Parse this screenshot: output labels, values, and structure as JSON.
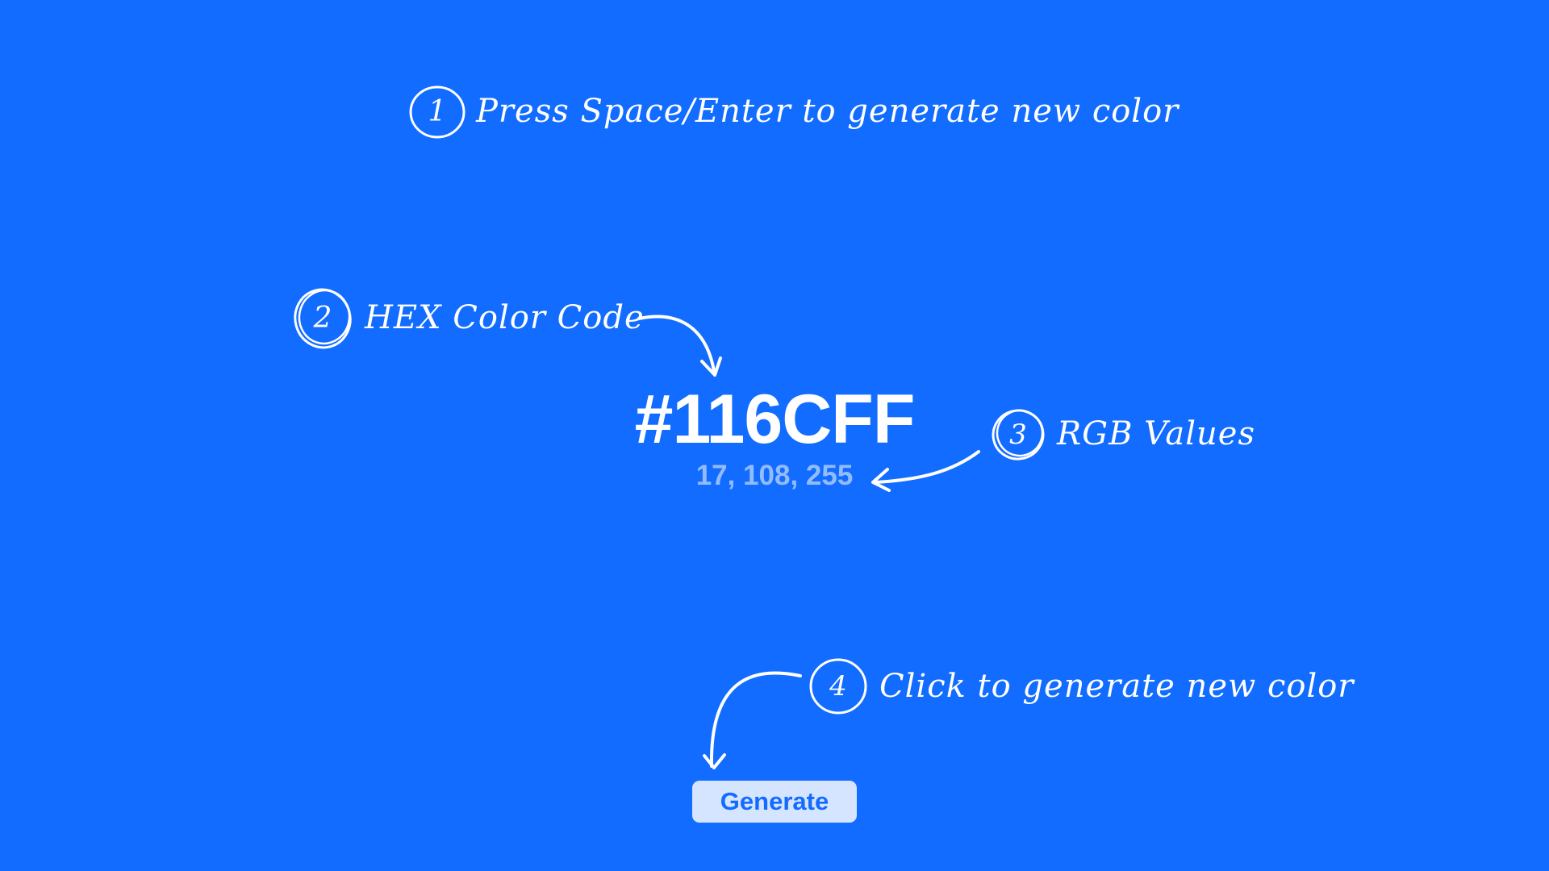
{
  "theme": {
    "background": "#116CFF",
    "text": "#ffffff",
    "button_bg": "#D6E5FF",
    "button_text": "#116CFF"
  },
  "color": {
    "hex": "#116CFF",
    "rgb": "17, 108, 255"
  },
  "annotations": [
    {
      "number": "1",
      "text": "Press Space/Enter to generate new color"
    },
    {
      "number": "2",
      "text": "HEX Color Code"
    },
    {
      "number": "3",
      "text": "RGB Values"
    },
    {
      "number": "4",
      "text": "Click to generate new color"
    }
  ],
  "generate_button": {
    "label": "Generate"
  }
}
